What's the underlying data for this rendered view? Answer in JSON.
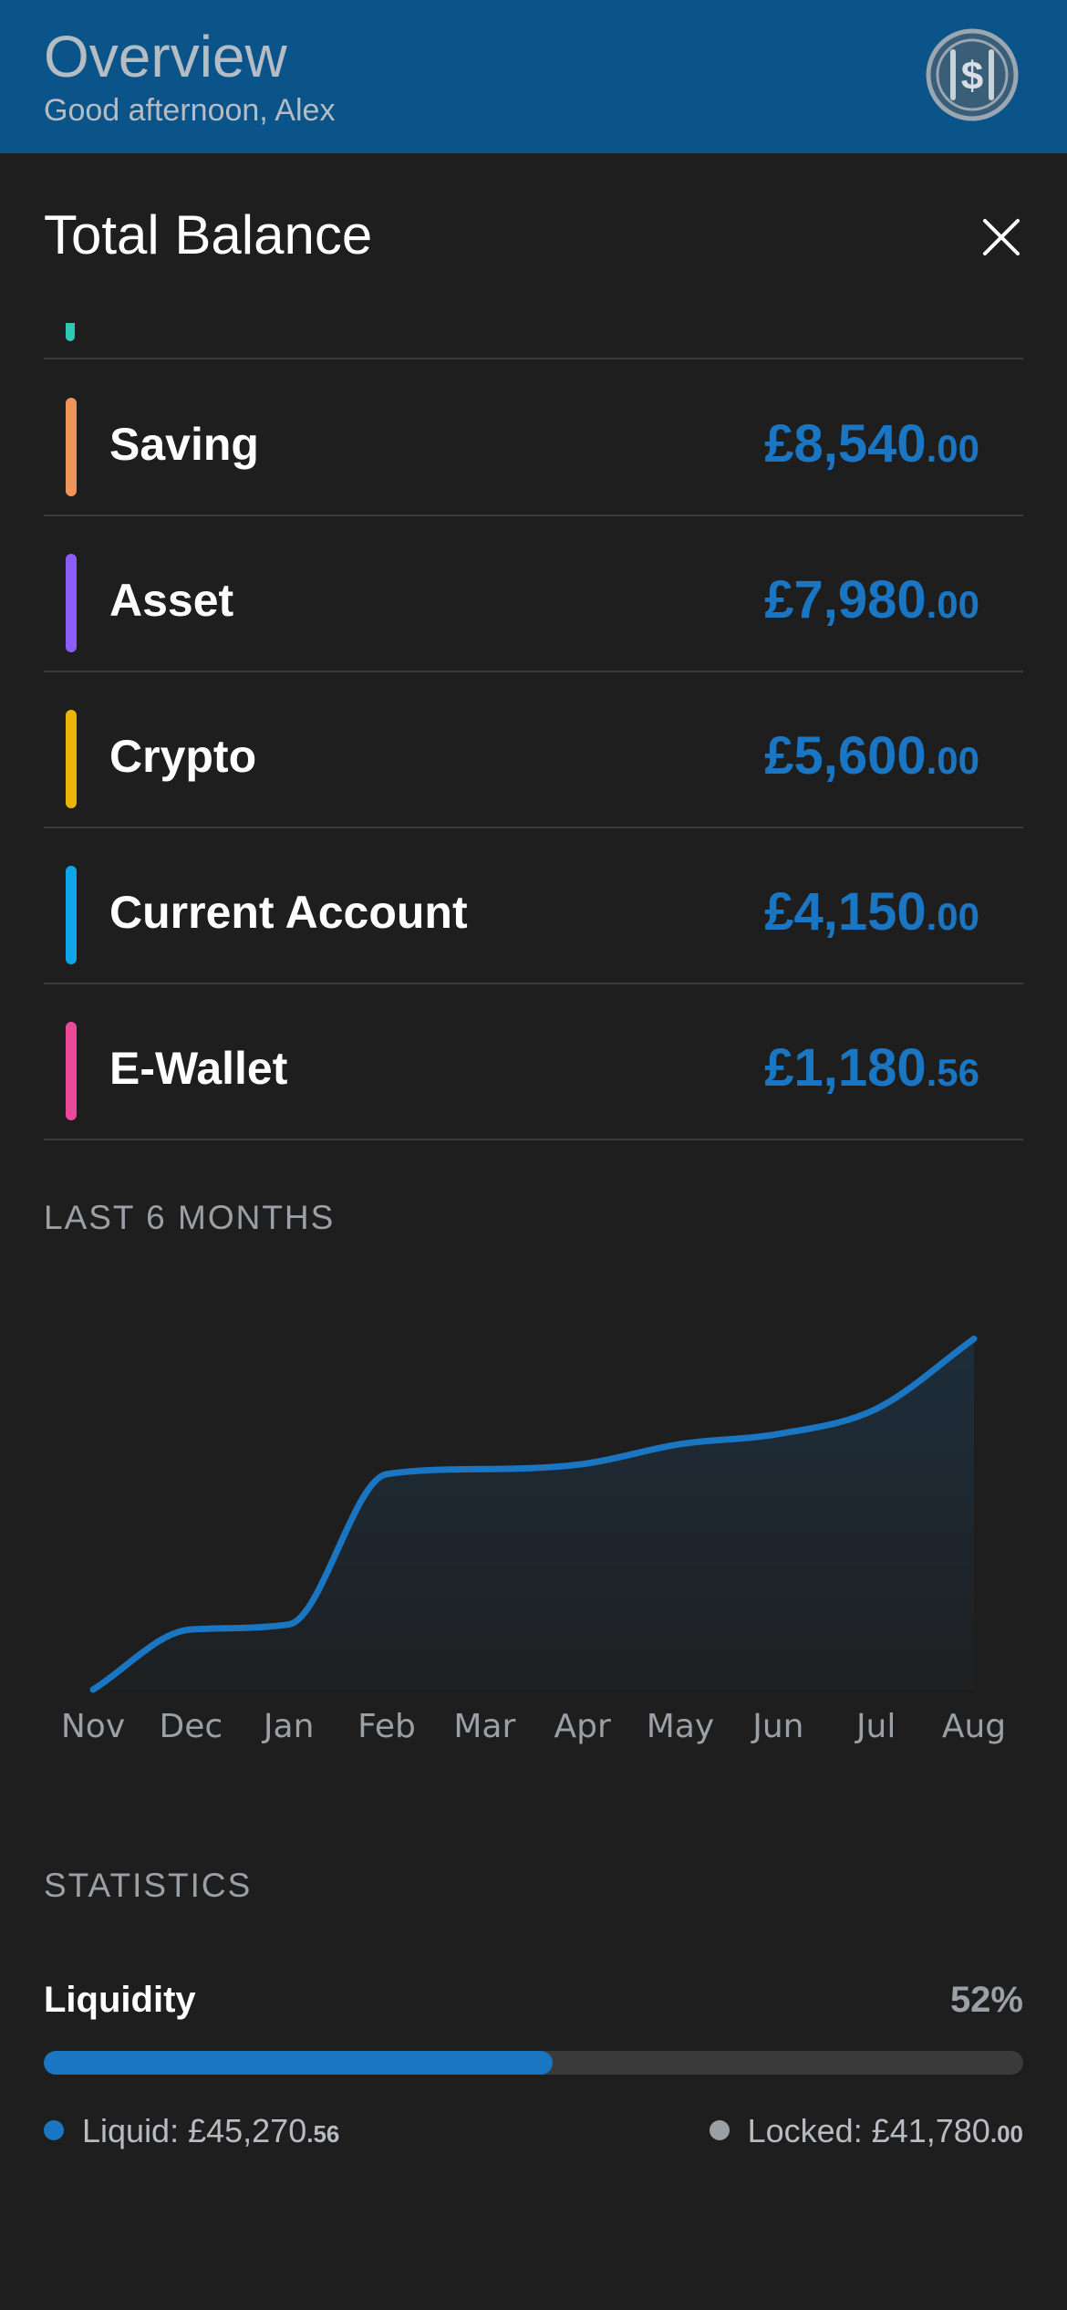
{
  "header": {
    "title": "Overview",
    "subtitle": "Good afternoon, Alex",
    "logo_icon": "dollar-coin-icon",
    "background": "#0b548a"
  },
  "sheet": {
    "title": "Total Balance",
    "close_icon": "close-icon"
  },
  "accounts": [
    {
      "label": "Saving",
      "amount_major": "£8,540",
      "amount_minor": ".00",
      "color": "#f0955a"
    },
    {
      "label": "Asset",
      "amount_major": "£7,980",
      "amount_minor": ".00",
      "color": "#8b5cf6"
    },
    {
      "label": "Crypto",
      "amount_major": "£5,600",
      "amount_minor": ".00",
      "color": "#eab308"
    },
    {
      "label": "Current Account",
      "amount_major": "£4,150",
      "amount_minor": ".00",
      "color": "#0ea5e9"
    },
    {
      "label": "E-Wallet",
      "amount_major": "£1,180",
      "amount_minor": ".56",
      "color": "#ec4899"
    }
  ],
  "peek_color": "#2ec9b5",
  "accent_color": "#1a76c2",
  "history": {
    "label": "LAST 6 MONTHS"
  },
  "chart_data": {
    "type": "area",
    "categories": [
      "Nov",
      "Dec",
      "Jan",
      "Feb",
      "Mar",
      "Apr",
      "May",
      "Jun",
      "Jul",
      "Aug"
    ],
    "values": [
      0,
      12,
      13,
      43,
      44,
      45,
      49,
      51,
      56,
      70
    ],
    "ylim": [
      0,
      75
    ],
    "grid": false,
    "title": "",
    "xlabel": "",
    "ylabel": ""
  },
  "statistics": {
    "label": "STATISTICS",
    "liquidity_label": "Liquidity",
    "liquidity_percent": "52%",
    "liquidity_fraction": 0.52,
    "liquid_text": "Liquid: £45,270",
    "liquid_minor": ".56",
    "locked_text": "Locked: £41,780",
    "locked_minor": ".00",
    "liquid_color": "#1a76c2",
    "locked_color": "#9aa0a6"
  }
}
